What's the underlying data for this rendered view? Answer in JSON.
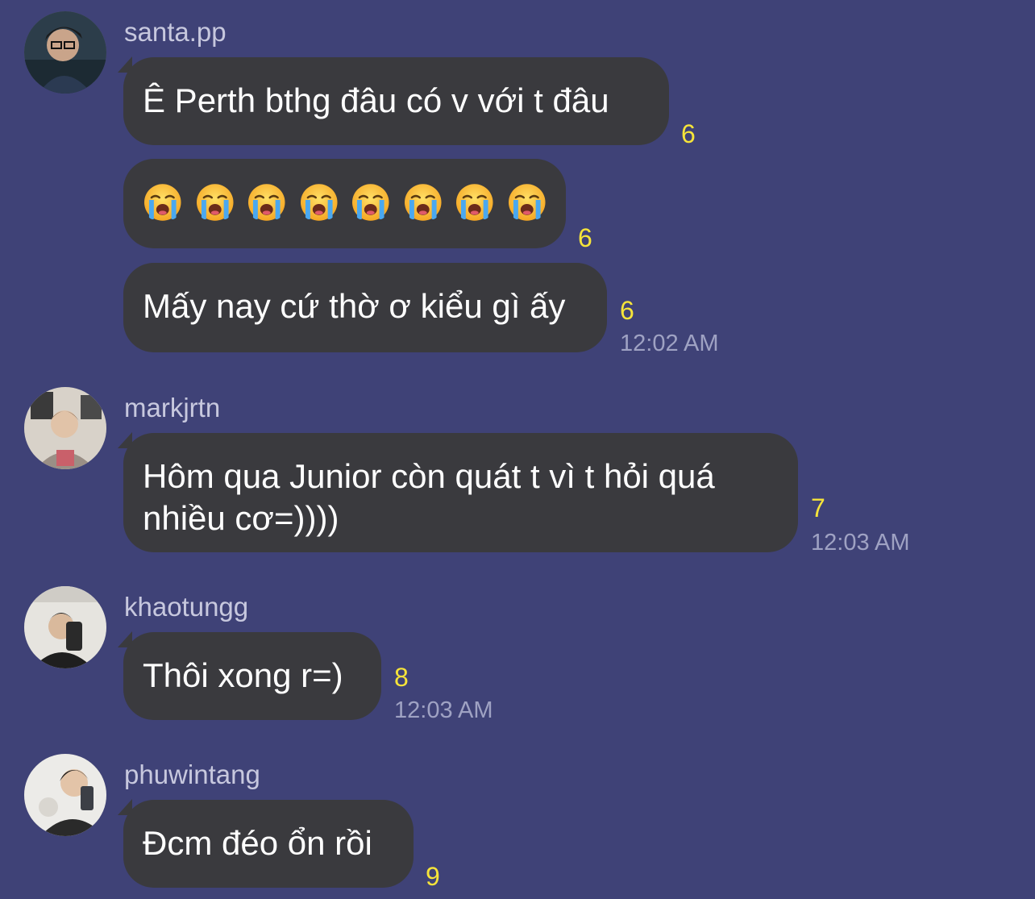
{
  "groups": [
    {
      "username": "santa.pp",
      "avatar_icon": "profile-photo-icon",
      "messages": [
        {
          "text": "Ê Perth bthg đâu có v với t đâu",
          "count": "6"
        },
        {
          "emoji_count": 8,
          "emoji_name": "loudly-crying-face-icon",
          "count": "6"
        },
        {
          "text": "Mấy nay cứ thờ ơ kiểu gì ấy",
          "count": "6",
          "time": "12:02 AM"
        }
      ]
    },
    {
      "username": "markjrtn",
      "avatar_icon": "profile-photo-icon",
      "messages": [
        {
          "text": "Hôm qua Junior còn quát t vì t hỏi quá nhiều cơ=))))",
          "count": "7",
          "time": "12:03 AM"
        }
      ]
    },
    {
      "username": "khaotungg",
      "avatar_icon": "profile-photo-icon",
      "messages": [
        {
          "text": "Thôi xong r=)",
          "count": "8",
          "time": "12:03 AM"
        }
      ]
    },
    {
      "username": "phuwintang",
      "avatar_icon": "profile-photo-icon",
      "messages": [
        {
          "text": "Đcm đéo ổn rồi",
          "count": "9"
        }
      ]
    }
  ],
  "colors": {
    "background": "#3f4277",
    "bubble": "#3a3a3e",
    "count": "#f6e43a",
    "timestamp": "#9fa2c3",
    "username": "#c7c8de"
  }
}
